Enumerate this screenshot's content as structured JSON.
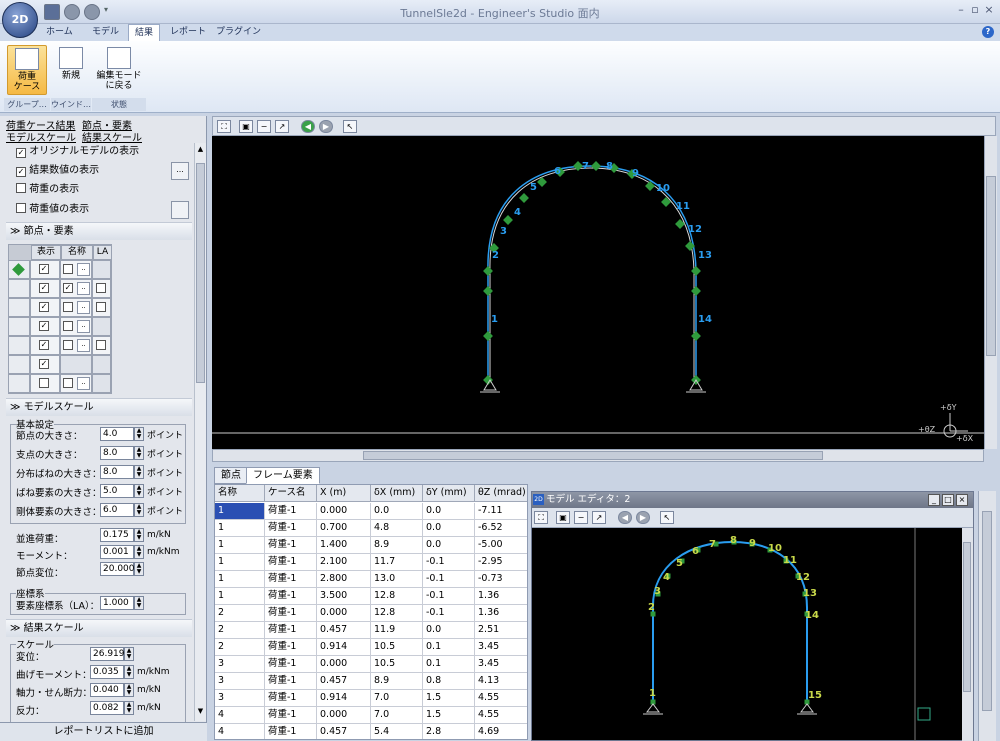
{
  "window": {
    "title": "TunnelSle2d - Engineer's Studio 面内",
    "app_logo": "2D"
  },
  "ribbon_tabs": [
    {
      "label": "ホーム"
    },
    {
      "label": "モデル"
    },
    {
      "label": "結果"
    },
    {
      "label": "レポート"
    },
    {
      "label": "プラグイン"
    }
  ],
  "ribbon": {
    "btn_load_case": "荷重\nケース",
    "btn_new": "新規",
    "btn_back_to_edit": "編集モード\nに戻る",
    "group_group": "グループ…",
    "group_window": "ウインド…",
    "group_state": "状態"
  },
  "left": {
    "links": [
      "荷重ケース結果",
      "節点・要素",
      "モデルスケール",
      "結果スケール"
    ],
    "opt_original_model": "オリジナルモデルの表示",
    "opt_result_values": "結果数値の表示",
    "opt_load_display": "荷重の表示",
    "opt_load_values": "荷重値の表示",
    "sec_nodes": "節点・要素",
    "col_display": "表示",
    "col_name": "名称",
    "col_la": "LA",
    "sec_model_scale": "モデルスケール",
    "basic_settings": "基本設定",
    "node_size": "節点の大きさ：",
    "node_size_val": "4.0",
    "support_size": "支点の大きさ：",
    "support_size_val": "8.0",
    "spring_size": "分布ばねの大きさ：",
    "spring_size_val": "8.0",
    "spring_elem_size": "ばね要素の大きさ：",
    "spring_elem_size_val": "5.0",
    "rigid_elem_size": "剛体要素の大きさ：",
    "rigid_elem_size_val": "6.0",
    "unit_point": "ポイント",
    "conc_load": "並進荷重：",
    "conc_load_val": "0.175",
    "conc_load_unit": "m/kN",
    "moment": "モーメント：",
    "moment_val": "0.001",
    "moment_unit": "m/kNm",
    "node_disp": "節点変位：",
    "node_disp_val": "20.000",
    "coord_group": "座標系",
    "elem_coord": "要素座標系（LA）：",
    "elem_coord_val": "1.000",
    "sec_result_scale": "結果スケール",
    "scale_group": "スケール",
    "disp": "変位：",
    "disp_val": "26.919",
    "bending": "曲げモーメント：",
    "bending_val": "0.035",
    "bending_unit": "m/kNm",
    "axial_shear": "軸力・せん断力：",
    "axial_shear_val": "0.040",
    "axial_shear_unit": "m/kN",
    "reaction": "反力：",
    "reaction_val": "0.082",
    "reaction_unit": "m/kN",
    "add_report": "レポートリストに追加"
  },
  "view": {
    "axis_y": "+δY",
    "axis_z": "+θZ",
    "axis_x": "+δX",
    "main_labels": [
      "1",
      "2",
      "3",
      "4",
      "5",
      "6",
      "7",
      "8",
      "9",
      "10",
      "11",
      "12",
      "13",
      "14"
    ],
    "editor_labels": [
      "1",
      "2",
      "3",
      "4",
      "5",
      "6",
      "7",
      "8",
      "9",
      "10",
      "11",
      "12",
      "13",
      "14",
      "15"
    ]
  },
  "bottom_tabs": [
    "節点",
    "フレーム要素"
  ],
  "grid": {
    "headers": [
      "名称",
      "ケース名",
      "X (m)",
      "δX (mm)",
      "δY (mm)",
      "θZ (mrad)"
    ],
    "rows": [
      [
        "1",
        "荷重-1",
        "0.000",
        "0.0",
        "0.0",
        "-7.11"
      ],
      [
        "1",
        "荷重-1",
        "0.700",
        "4.8",
        "0.0",
        "-6.52"
      ],
      [
        "1",
        "荷重-1",
        "1.400",
        "8.9",
        "0.0",
        "-5.00"
      ],
      [
        "1",
        "荷重-1",
        "2.100",
        "11.7",
        "-0.1",
        "-2.95"
      ],
      [
        "1",
        "荷重-1",
        "2.800",
        "13.0",
        "-0.1",
        "-0.73"
      ],
      [
        "1",
        "荷重-1",
        "3.500",
        "12.8",
        "-0.1",
        "1.36"
      ],
      [
        "2",
        "荷重-1",
        "0.000",
        "12.8",
        "-0.1",
        "1.36"
      ],
      [
        "2",
        "荷重-1",
        "0.457",
        "11.9",
        "0.0",
        "2.51"
      ],
      [
        "2",
        "荷重-1",
        "0.914",
        "10.5",
        "0.1",
        "3.45"
      ],
      [
        "3",
        "荷重-1",
        "0.000",
        "10.5",
        "0.1",
        "3.45"
      ],
      [
        "3",
        "荷重-1",
        "0.457",
        "8.9",
        "0.8",
        "4.13"
      ],
      [
        "3",
        "荷重-1",
        "0.914",
        "7.0",
        "1.5",
        "4.55"
      ],
      [
        "4",
        "荷重-1",
        "0.000",
        "7.0",
        "1.5",
        "4.55"
      ],
      [
        "4",
        "荷重-1",
        "0.457",
        "5.4",
        "2.8",
        "4.69"
      ]
    ]
  },
  "editor": {
    "title": "モデル エディタ：2"
  }
}
